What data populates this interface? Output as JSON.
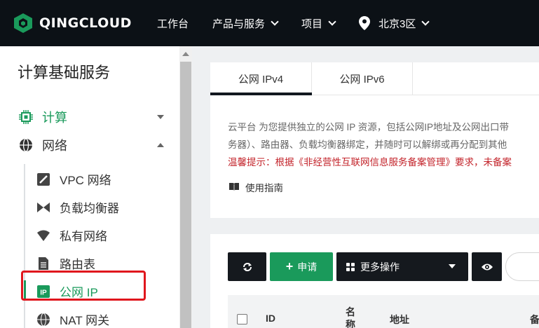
{
  "header": {
    "brand": "QINGCLOUD",
    "nav": [
      "工作台",
      "产品与服务",
      "项目",
      "北京3区"
    ]
  },
  "sidebar": {
    "title": "计算基础服务",
    "groups": [
      {
        "label": "计算",
        "icon": "chip-icon",
        "expanded": false
      },
      {
        "label": "网络",
        "icon": "globe-icon",
        "expanded": true
      }
    ],
    "items": [
      {
        "label": "VPC 网络",
        "icon": "vpc-icon"
      },
      {
        "label": "负载均衡器",
        "icon": "load-balancer-icon"
      },
      {
        "label": "私有网络",
        "icon": "wifi-icon"
      },
      {
        "label": "路由表",
        "icon": "document-icon"
      },
      {
        "label": "公网 IP",
        "icon": "ip-icon",
        "active": true
      },
      {
        "label": "NAT 网关",
        "icon": "nat-icon"
      }
    ]
  },
  "tabs": [
    "公网 IPv4",
    "公网 IPv6"
  ],
  "description": {
    "line1": "云平台 为您提供独立的公网 IP 资源，包括公网IP地址及公网出口带",
    "line2": "务器）、路由器、负载均衡器绑定，并随时可以解绑或再分配到其他",
    "warning": "温馨提示：根据《非经营性互联网信息服务备案管理》要求，未备案",
    "guide": "使用指南"
  },
  "toolbar": {
    "apply": "申请",
    "more": "更多操作"
  },
  "table": {
    "headers": [
      "ID",
      "名称",
      "地址",
      "备"
    ]
  },
  "colors": {
    "accent": "#1a9a5b",
    "header_bg": "#0c1116",
    "warning": "#c3232a",
    "annotation": "#e0161d"
  }
}
